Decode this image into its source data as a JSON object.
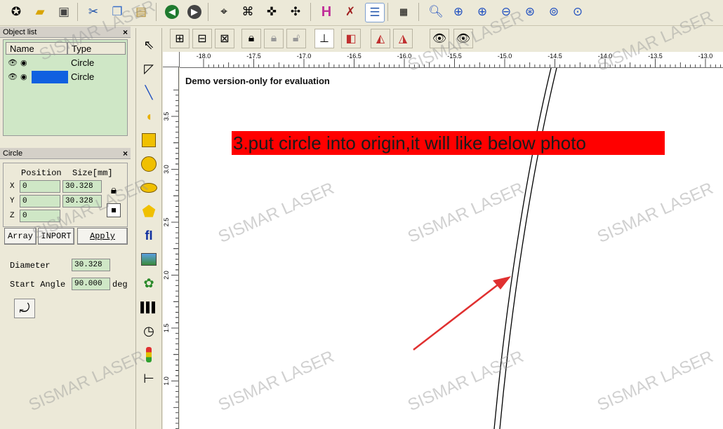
{
  "toolbar": {
    "icons": [
      "new-file-icon",
      "open-folder-icon",
      "save-icon",
      "cut-icon",
      "copy-icon",
      "paste-icon",
      "back-icon",
      "forward-icon",
      "node-edit-icon",
      "node-select-icon",
      "node-move-icon",
      "node-add-icon",
      "hatch-icon",
      "tools-icon",
      "list-icon",
      "barcode-icon",
      "zoom-icon",
      "zoom-in-icon",
      "zoom-in-2-icon",
      "zoom-out-icon",
      "zoom-fit-icon",
      "zoom-all-icon",
      "zoom-select-icon"
    ]
  },
  "object_list": {
    "title": "Object list",
    "close": "×",
    "col_name": "Name",
    "col_type": "Type",
    "rows": [
      {
        "type": "Circle"
      },
      {
        "type": "Circle"
      }
    ]
  },
  "circle_panel": {
    "title": "Circle",
    "close": "×",
    "position_label": "Position",
    "size_label": "Size[mm]",
    "x_label": "X",
    "y_label": "Y",
    "z_label": "Z",
    "x_value": "0",
    "y_value": "0",
    "z_value": "0",
    "size_x": "30.328",
    "size_y": "30.328",
    "array_button": "Array",
    "import_button": "INPORT",
    "apply_button": "Apply",
    "diameter_label": "Diameter",
    "diameter_value": "30.328",
    "start_angle_label": "Start Angle",
    "start_angle_value": "90.000",
    "deg_label": "deg"
  },
  "ruler": {
    "h_ticks": [
      "-18.0",
      "-17.5",
      "-17.0",
      "-16.5",
      "-16.0",
      "-15.5",
      "-15.0",
      "-14.5",
      "-14.0",
      "-13.5",
      "-13.0"
    ],
    "v_ticks": [
      "3.5",
      "3.0",
      "2.5",
      "2.0",
      "1.5",
      "1.0"
    ]
  },
  "canvas": {
    "demo_text": "Demo version-only for evaluation",
    "banner_text": "3.put circle into origin,it will like below photo"
  },
  "watermark": "SISMAR LASER",
  "colors": {
    "panel_green": "#cfe7c6",
    "banner_red": "#ff0000",
    "arrow_red": "#e03030"
  }
}
